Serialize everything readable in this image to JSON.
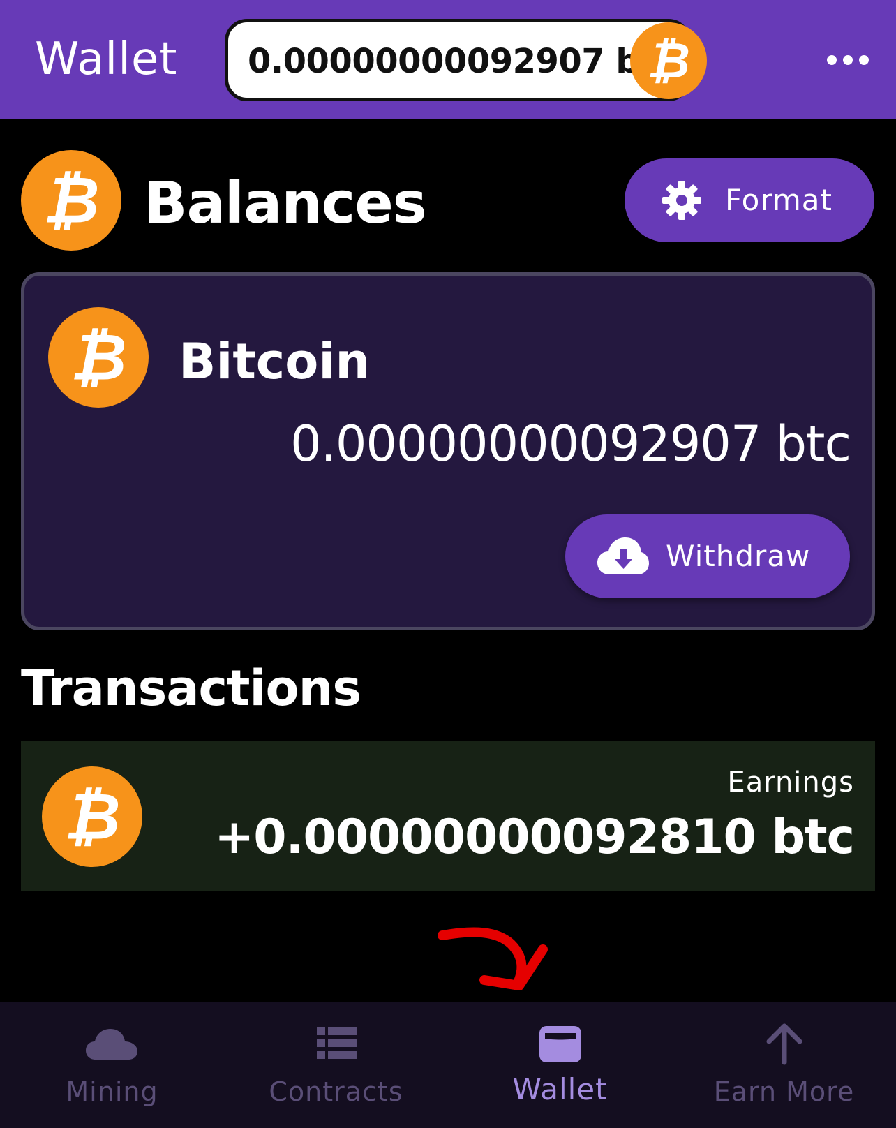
{
  "header": {
    "title": "Wallet",
    "balance_pill": "0.00000000092907 btc",
    "more_icon": "more-horizontal-icon"
  },
  "balances": {
    "title": "Balances",
    "format_label": "Format",
    "format_icon": "gear-icon"
  },
  "wallet_card": {
    "currency": "Bitcoin",
    "amount": "0.00000000092907 btc",
    "withdraw_label": "Withdraw",
    "withdraw_icon": "cloud-download-icon"
  },
  "transactions": {
    "title": "Transactions",
    "items": [
      {
        "type": "Earnings",
        "amount": "+0.00000000092810 btc",
        "icon": "bitcoin-icon"
      }
    ]
  },
  "bottom_nav": {
    "items": [
      {
        "label": "Mining",
        "icon": "cloud-icon",
        "active": false
      },
      {
        "label": "Contracts",
        "icon": "list-icon",
        "active": false
      },
      {
        "label": "Wallet",
        "icon": "wallet-icon",
        "active": true
      },
      {
        "label": "Earn More",
        "icon": "arrow-up-icon",
        "active": false
      }
    ]
  },
  "colors": {
    "primary": "#673ab7",
    "bitcoin": "#f7931a",
    "card_bg": "#24183f",
    "tx_bg": "#172215",
    "nav_bg": "#140e20",
    "nav_inactive": "#5a4e77",
    "nav_active": "#a48ce0",
    "annotation": "#e50000"
  }
}
